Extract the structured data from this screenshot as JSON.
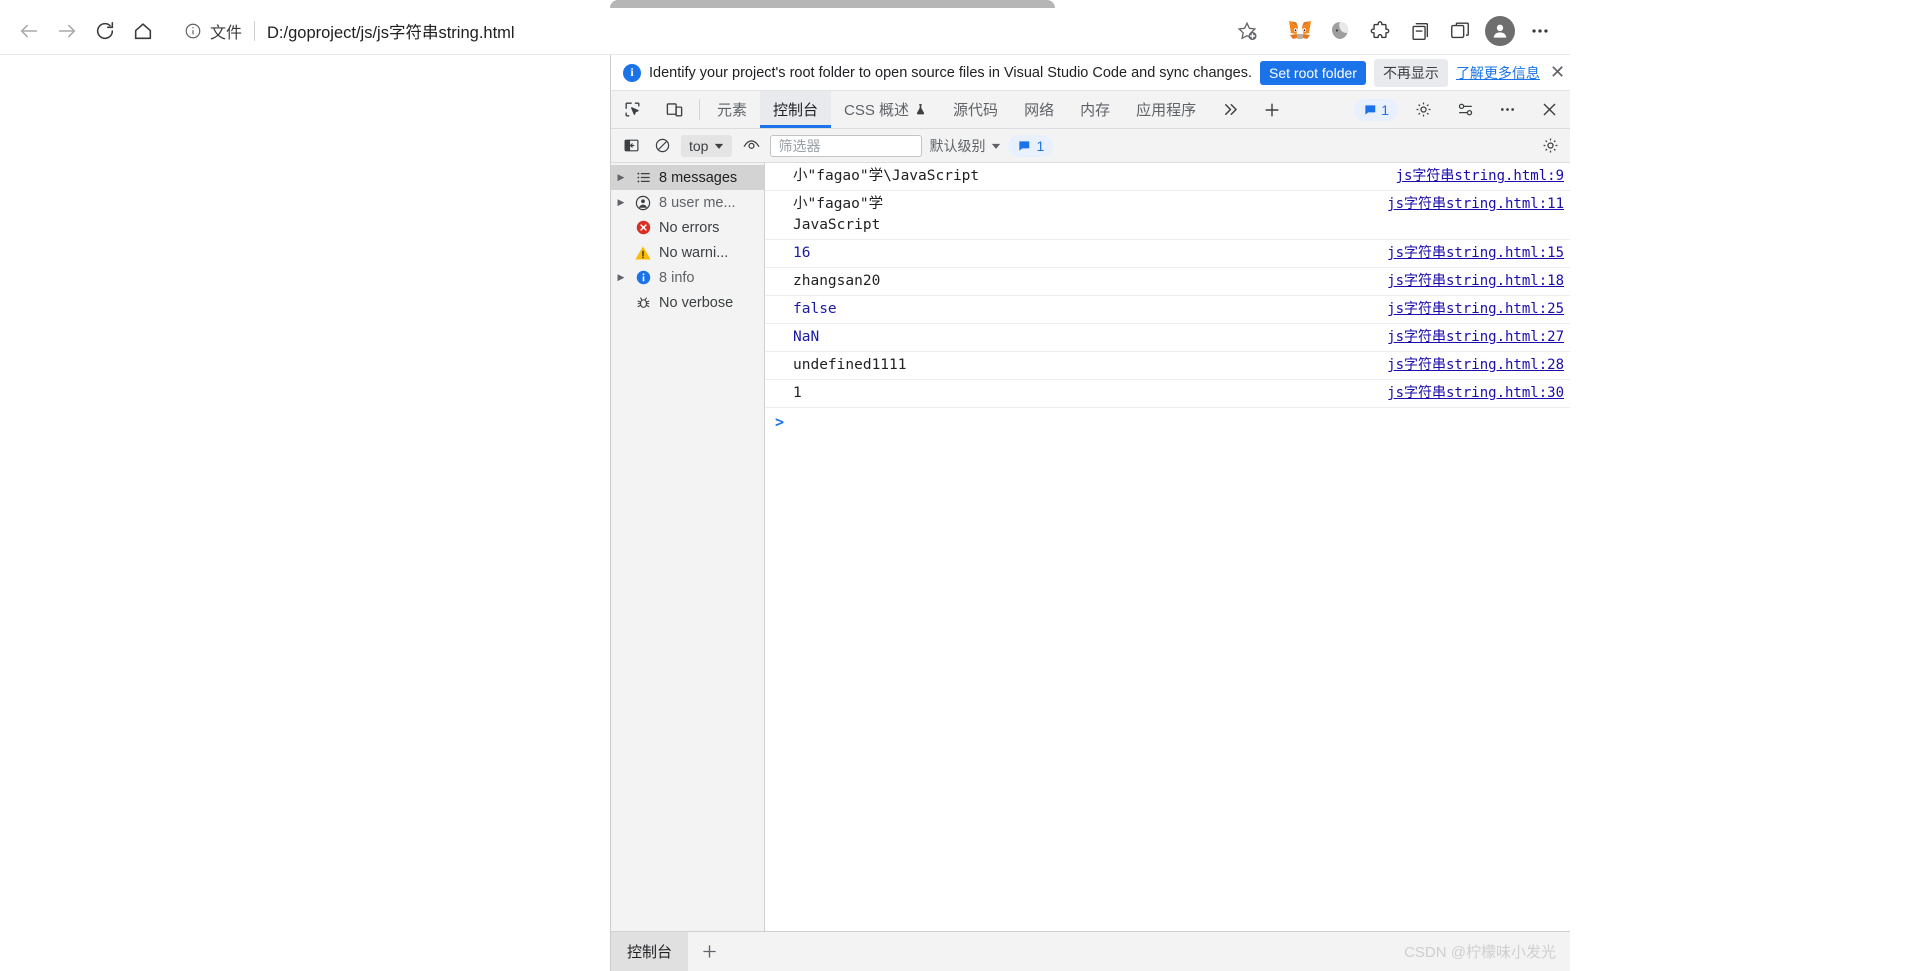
{
  "browser": {
    "nav": {
      "back_icon": "arrow-left-icon",
      "forward_icon": "arrow-right-icon",
      "reload_icon": "reload-icon",
      "home_icon": "home-icon"
    },
    "omnibox": {
      "info_icon": "info-circle-icon",
      "file_label": "文件",
      "url": "D:/goproject/js/js字符串string.html",
      "favorite_icon": "add-favorite-star-icon"
    },
    "extensions": [
      {
        "name": "metamask-extension-icon",
        "label": "MetaMask"
      },
      {
        "name": "extension-icon",
        "label": "Extension"
      },
      {
        "name": "puzzle-extensions-icon",
        "label": "Extensions"
      },
      {
        "name": "collections-icon",
        "label": "Collections"
      },
      {
        "name": "browser-essentials-icon",
        "label": "Browser essentials"
      }
    ],
    "profile_icon": "profile-avatar-icon",
    "more_icon": "more-settings-ellipsis-icon"
  },
  "devtools": {
    "infobar": {
      "icon": "info-circle-icon",
      "message": "Identify your project's root folder to open source files in Visual Studio Code and sync changes.",
      "primary_button": "Set root folder",
      "secondary_button": "不再显示",
      "learn_more": "了解更多信息",
      "close_icon": "close-icon"
    },
    "tabs": {
      "inspect_icon": "inspect-element-icon",
      "device_toolbar_icon": "device-toolbar-icon",
      "items": [
        {
          "label": "元素",
          "active": false,
          "icon": null
        },
        {
          "label": "控制台",
          "active": true,
          "icon": null
        },
        {
          "label": "CSS 概述",
          "active": false,
          "icon": "experiment-flask-icon"
        },
        {
          "label": "源代码",
          "active": false,
          "icon": null
        },
        {
          "label": "网络",
          "active": false,
          "icon": null
        },
        {
          "label": "内存",
          "active": false,
          "icon": null
        },
        {
          "label": "应用程序",
          "active": false,
          "icon": null
        }
      ],
      "more_tabs_icon": "chevron-double-right-icon",
      "add_tab_icon": "plus-icon",
      "issues_badge": "1",
      "issues_icon": "message-bubble-icon",
      "settings_icon": "gear-icon",
      "customize_icon": "customize-devtools-icon",
      "more_icon": "more-options-ellipsis-icon",
      "close_icon": "close-devtools-icon"
    },
    "console_toolbar": {
      "sidebar_toggle_icon": "console-sidebar-toggle-icon",
      "clear_icon": "clear-console-icon",
      "context": "top",
      "context_chevron": "chevron-down-icon",
      "eye_icon": "live-expression-eye-icon",
      "filter_placeholder": "筛选器",
      "level": "默认级别",
      "level_chevron": "chevron-down-icon",
      "message_badge": "1",
      "message_badge_icon": "message-bubble-icon",
      "settings_icon": "gear-icon"
    },
    "console_sidebar": [
      {
        "label": "8 messages",
        "icon": "list-messages-icon",
        "selected": true,
        "expandable": true
      },
      {
        "label": "8 user me...",
        "icon": "user-message-icon",
        "selected": false,
        "expandable": true
      },
      {
        "label": "No errors",
        "icon": "error-circle-icon",
        "selected": false,
        "expandable": false
      },
      {
        "label": "No warni...",
        "icon": "warning-triangle-icon",
        "selected": false,
        "expandable": false
      },
      {
        "label": "8 info",
        "icon": "info-circle-icon",
        "selected": false,
        "expandable": true
      },
      {
        "label": "No verbose",
        "icon": "bug-verbose-icon",
        "selected": false,
        "expandable": false
      }
    ],
    "console_log": [
      {
        "text": "小\"fagao\"学\\JavaScript",
        "type": "string",
        "source": "js字符串string.html:9"
      },
      {
        "text": "小\"fagao\"学\nJavaScript",
        "type": "string",
        "source": "js字符串string.html:11"
      },
      {
        "text": "16",
        "type": "number",
        "source": "js字符串string.html:15"
      },
      {
        "text": "zhangsan20",
        "type": "string",
        "source": "js字符串string.html:18"
      },
      {
        "text": "false",
        "type": "bool",
        "source": "js字符串string.html:25"
      },
      {
        "text": "NaN",
        "type": "number",
        "source": "js字符串string.html:27"
      },
      {
        "text": "undefined1111",
        "type": "string",
        "source": "js字符串string.html:28"
      },
      {
        "text": "1",
        "type": "string",
        "source": "js字符串string.html:30"
      }
    ],
    "prompt_caret": ">",
    "drawer": {
      "tab_label": "控制台",
      "add_icon": "plus-icon"
    }
  },
  "watermark": "CSDN @柠檬味小发光"
}
